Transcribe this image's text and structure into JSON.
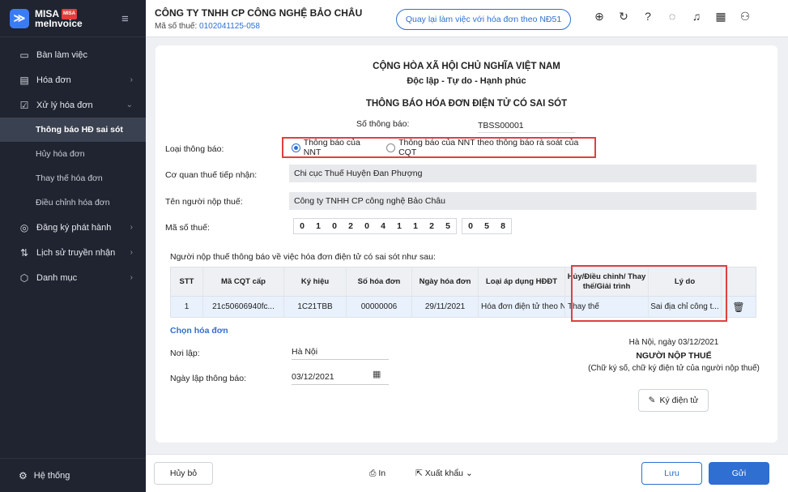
{
  "app": {
    "logo_top": "MISA",
    "logo_badge": "MISA",
    "logo_bottom": "meInvoice"
  },
  "sidebar": {
    "items": [
      {
        "label": "Bàn làm việc",
        "icon": "monitor-icon"
      },
      {
        "label": "Hóa đơn",
        "icon": "document-icon"
      },
      {
        "label": "Xử lý hóa đơn",
        "icon": "edit-document-icon"
      }
    ],
    "sub_items": [
      {
        "label": "Thông báo HĐ sai sót",
        "active": true
      },
      {
        "label": "Hủy hóa đơn"
      },
      {
        "label": "Thay thế hóa đơn"
      },
      {
        "label": "Điều chỉnh hóa đơn"
      }
    ],
    "items2": [
      {
        "label": "Đăng ký phát hành",
        "icon": "register-icon"
      },
      {
        "label": "Lịch sử truyền nhận",
        "icon": "transfer-icon"
      },
      {
        "label": "Danh mục",
        "icon": "box-icon"
      }
    ],
    "footer": "Hệ thống"
  },
  "header": {
    "company": "CÔNG TY TNHH CP CÔNG NGHỆ BẢO CHÂU",
    "mst_label": "Mã số thuế:",
    "mst_value": "0102041125-058",
    "back_button": "Quay lại làm việc với hóa đơn theo NĐ51"
  },
  "form": {
    "title1": "CỘNG HÒA XÃ HỘI CHỦ NGHĨA VIỆT NAM",
    "title2": "Độc lập - Tự do - Hạnh phúc",
    "title3": "THÔNG BÁO HÓA ĐƠN ĐIỆN TỬ CÓ SAI SÓT",
    "so_tb_label": "Số thông báo:",
    "so_tb_value": "TBSS00001",
    "loai_tb_label": "Loại thông báo:",
    "radio1": "Thông báo của NNT",
    "radio2": "Thông báo của NNT theo thông báo rà soát của CQT",
    "co_quan_label": "Cơ quan thuế tiếp nhận:",
    "co_quan_value": "Chi cục Thuế Huyện Đan Phượng",
    "ten_nnt_label": "Tên người nộp thuế:",
    "ten_nnt_value": "Công ty TNHH CP công nghệ Bảo Châu",
    "mst_label": "Mã số thuế:",
    "mst_digits": [
      "0",
      "1",
      "0",
      "2",
      "0",
      "4",
      "1",
      "1",
      "2",
      "5"
    ],
    "mst_suffix": [
      "0",
      "5",
      "8"
    ],
    "table_intro": "Người nộp thuế thông báo về việc hóa đơn điện tử có sai sót như sau:",
    "table": {
      "headers": [
        "STT",
        "Mã CQT cấp",
        "Ký hiệu",
        "Số hóa đơn",
        "Ngày hóa đơn",
        "Loại áp dụng HĐĐT",
        "Hủy/Điều chỉnh/ Thay thế/Giải trình",
        "Lý do"
      ],
      "rows": [
        [
          "1",
          "21c50606940fc...",
          "1C21TBB",
          "00000006",
          "29/11/2021",
          "Hóa đơn điện tử theo Ng",
          "Thay thế",
          "Sai địa chỉ công t..."
        ]
      ]
    },
    "chon_hoa_don": "Chọn hóa đơn",
    "noi_lap_label": "Nơi lập:",
    "noi_lap_value": "Hà Nội",
    "ngay_lap_label": "Ngày lập thông báo:",
    "ngay_lap_value": "03/12/2021",
    "sig_date": "Hà Nội, ngày 03/12/2021",
    "sig_title": "NGƯỜI NỘP THUẾ",
    "sig_note": "(Chữ ký số, chữ ký điện tử của người nộp thuế)",
    "sign_button": "Ký điện tử"
  },
  "footer": {
    "cancel": "Hủy bỏ",
    "print": "In",
    "export": "Xuất khẩu",
    "save": "Lưu",
    "send": "Gửi"
  },
  "colors": {
    "sidebar_bg": "#1f2430",
    "accent": "#2f6fd1",
    "highlight_border": "#e04040"
  }
}
